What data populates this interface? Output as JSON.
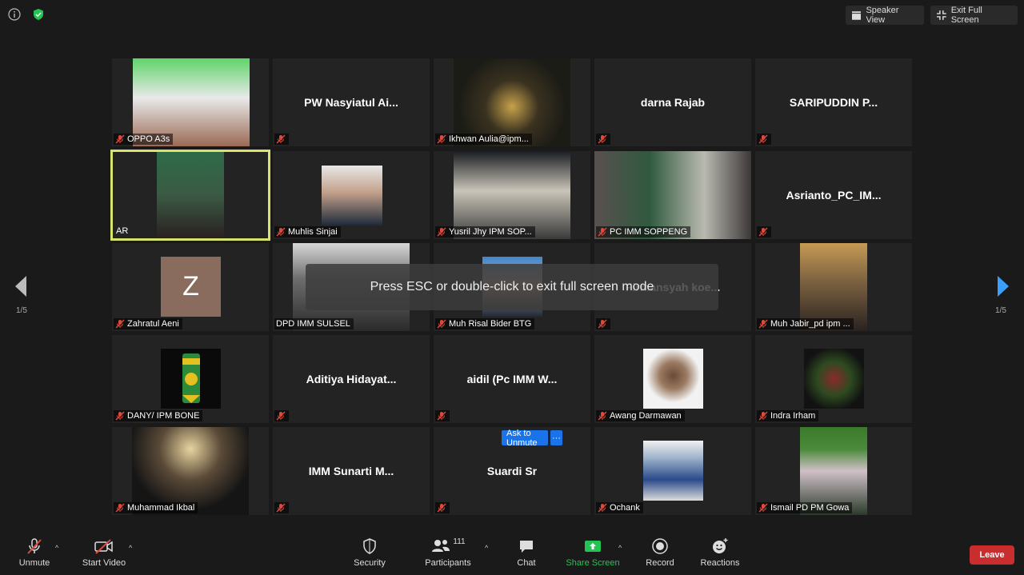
{
  "top": {
    "speaker_view": "Speaker View",
    "exit_full_screen": "Exit Full Screen"
  },
  "tiles": [
    {
      "name": "OPPO A3s",
      "display": "",
      "muted": true,
      "video": true
    },
    {
      "name": "",
      "display": "PW  Nasyiatul  Ai...",
      "muted": true,
      "video": false
    },
    {
      "name": "Ikhwan Aulia@ipm...",
      "display": "",
      "muted": true,
      "video": true
    },
    {
      "name": "",
      "display": "darna Rajab",
      "muted": true,
      "video": false
    },
    {
      "name": "",
      "display": "SARIPUDDIN  P...",
      "muted": true,
      "video": false
    },
    {
      "name": "AR",
      "display": "",
      "muted": false,
      "video": true
    },
    {
      "name": "Muhlis Sinjai",
      "display": "",
      "muted": true,
      "video": true
    },
    {
      "name": "Yusril Jhy IPM SOP...",
      "display": "",
      "muted": true,
      "video": true
    },
    {
      "name": "PC IMM SOPPENG",
      "display": "",
      "muted": true,
      "video": true
    },
    {
      "name": "",
      "display": "Asrianto_PC_IM...",
      "muted": true,
      "video": false
    },
    {
      "name": "Zahratul Aeni",
      "display": "",
      "muted": true,
      "video": true
    },
    {
      "name": "DPD IMM SULSEL",
      "display": "",
      "muted": false,
      "video": true
    },
    {
      "name": "Muh Risal Bider BTG",
      "display": "",
      "muted": true,
      "video": true
    },
    {
      "name": "",
      "display": "Firmansyah  koe...",
      "muted": true,
      "video": false
    },
    {
      "name": "Muh Jabir_pd ipm ...",
      "display": "",
      "muted": true,
      "video": true
    },
    {
      "name": "DANY/ IPM BONE",
      "display": "",
      "muted": true,
      "video": true
    },
    {
      "name": "",
      "display": "Aditiya  Hidayat...",
      "muted": true,
      "video": false
    },
    {
      "name": "",
      "display": "aidil  (Pc IMM W...",
      "muted": true,
      "video": false
    },
    {
      "name": "Awang Darmawan",
      "display": "",
      "muted": true,
      "video": true
    },
    {
      "name": "Indra Irham",
      "display": "",
      "muted": true,
      "video": true
    },
    {
      "name": "Muhammad Ikbal",
      "display": "",
      "muted": true,
      "video": true
    },
    {
      "name": "",
      "display": "IMM  Sunarti  M...",
      "muted": true,
      "video": false
    },
    {
      "name": "",
      "display": "Suardi Sr",
      "muted": true,
      "video": false
    },
    {
      "name": "Ochank",
      "display": "",
      "muted": true,
      "video": true
    },
    {
      "name": "Ismail PD PM Gowa",
      "display": "",
      "muted": true,
      "video": true
    }
  ],
  "avatar_letter": "Z",
  "ask_to_unmute": "Ask to Unmute",
  "more_dots": "···",
  "toast": "Press ESC or double-click to exit full screen mode",
  "page_left": "1/5",
  "page_right": "1/5",
  "toolbar": {
    "unmute": "Unmute",
    "start_video": "Start Video",
    "security": "Security",
    "participants": "Participants",
    "participants_count": "111",
    "chat": "Chat",
    "share_screen": "Share Screen",
    "record": "Record",
    "reactions": "Reactions",
    "leave": "Leave"
  },
  "colors": {
    "active_speaker": "#d7e36a",
    "muted_icon": "#e0493a",
    "share_green": "#23c552",
    "leave_red": "#c92d2d",
    "ask_blue": "#1a73e8"
  }
}
